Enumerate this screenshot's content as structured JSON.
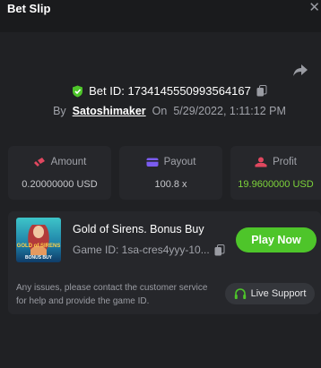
{
  "header": {
    "title": "Bet Slip",
    "close_glyph": "✕"
  },
  "bet": {
    "id_label": "Bet ID: 1734145550993564167",
    "by_label": "By",
    "user": "Satoshimaker",
    "on_label": "On",
    "date": "5/29/2022, 1:11:12 PM",
    "verified_color": "#4ec52a"
  },
  "stats": {
    "amount": {
      "label": "Amount",
      "value": "0.20000000 USD",
      "icon": "coin-hand-icon",
      "color": "#e0475f"
    },
    "payout": {
      "label": "Payout",
      "value": "100.8 x",
      "icon": "wallet-icon",
      "color": "#7b5cf0"
    },
    "profit": {
      "label": "Profit",
      "value": "19.9600000 USD",
      "icon": "hand-coin-icon",
      "color": "#e0475f",
      "value_color": "#7dd43a"
    }
  },
  "game": {
    "title": "Gold of Sirens. Bonus Buy",
    "id_label": "Game ID: 1sa-cres4yyy-10...",
    "play_label": "Play Now",
    "thumb_text_top": "GOLD of SIRENS",
    "thumb_text_bottom": "BONUS BUY"
  },
  "support": {
    "text": "Any issues, please contact the customer service for help and provide the game ID.",
    "button_label": "Live Support"
  },
  "colors": {
    "accent_green": "#4ec52a",
    "background": "#1a1b1d",
    "card": "#26272b"
  }
}
